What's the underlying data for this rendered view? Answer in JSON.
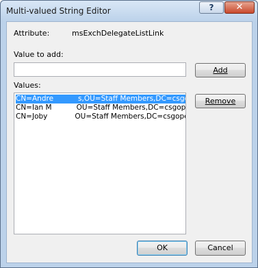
{
  "window": {
    "title": "Multi-valued String Editor",
    "close_glyph": "✕",
    "help_glyph": "?"
  },
  "attribute": {
    "label": "Attribute:",
    "value": "msExchDelegateListLink"
  },
  "value_to_add": {
    "label": "Value to add:",
    "value": ""
  },
  "values": {
    "label": "Values:",
    "items": [
      {
        "text": "CN=Andre",
        "rest": "s,OU=Staff Members,DC=csgopenl",
        "selected": true
      },
      {
        "text": "CN=Ian M",
        "rest": "OU=Staff Members,DC=csgopenlir",
        "selected": false
      },
      {
        "text": "CN=Joby",
        "rest": "OU=Staff Members,DC=csgopenlir",
        "selected": false
      }
    ]
  },
  "buttons": {
    "add": "Add",
    "remove": "Remove",
    "ok": "OK",
    "cancel": "Cancel"
  }
}
